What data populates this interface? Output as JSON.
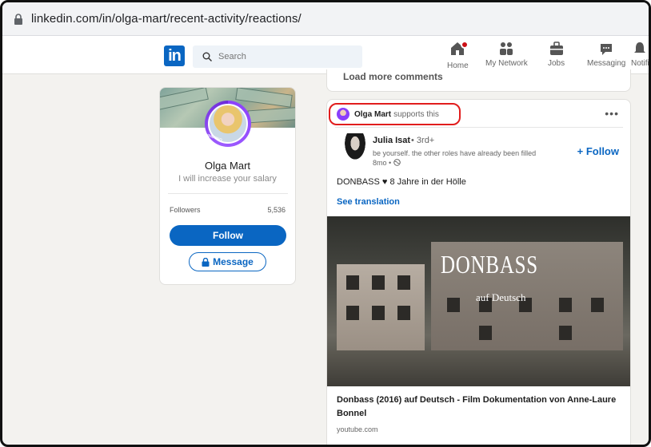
{
  "browser": {
    "url": "linkedin.com/in/olga-mart/recent-activity/reactions/"
  },
  "nav": {
    "logo": "in",
    "search_placeholder": "Search",
    "items": [
      {
        "label": "Home",
        "icon": "home-icon"
      },
      {
        "label": "My Network",
        "icon": "network-icon"
      },
      {
        "label": "Jobs",
        "icon": "briefcase-icon"
      },
      {
        "label": "Messaging",
        "icon": "messaging-icon"
      },
      {
        "label": "Notifi",
        "icon": "bell-icon"
      }
    ]
  },
  "profile": {
    "name": "Olga Mart",
    "tagline": "I will increase your salary",
    "hiring_frame": "#HIRING",
    "followers_label": "Followers",
    "followers_value": "5,536",
    "follow_label": "Follow",
    "message_label": "Message"
  },
  "feed": {
    "load_more": "Load more comments",
    "post": {
      "actor_name": "Olga Mart",
      "actor_action": "supports this",
      "menu": "•••",
      "author_name": "Julia Isat",
      "author_degree": "• 3rd+",
      "author_headline": "be yourself. the other roles have already been filled",
      "author_time": "8mo •",
      "follow_label": "+ Follow",
      "text_before": "DONBASS",
      "text_after": "8 Jahre in der Hölle",
      "see_translation": "See translation",
      "video_title": "DONBASS",
      "video_subtitle": "auf Deutsch",
      "link_title": "Donbass (2016) auf Deutsch - Film Dokumentation von Anne-Laure Bonnel",
      "link_domain": "youtube.com"
    }
  },
  "colors": {
    "brand": "#0a66c2",
    "highlight": "#e11d1d",
    "background": "#f3f2ef"
  }
}
